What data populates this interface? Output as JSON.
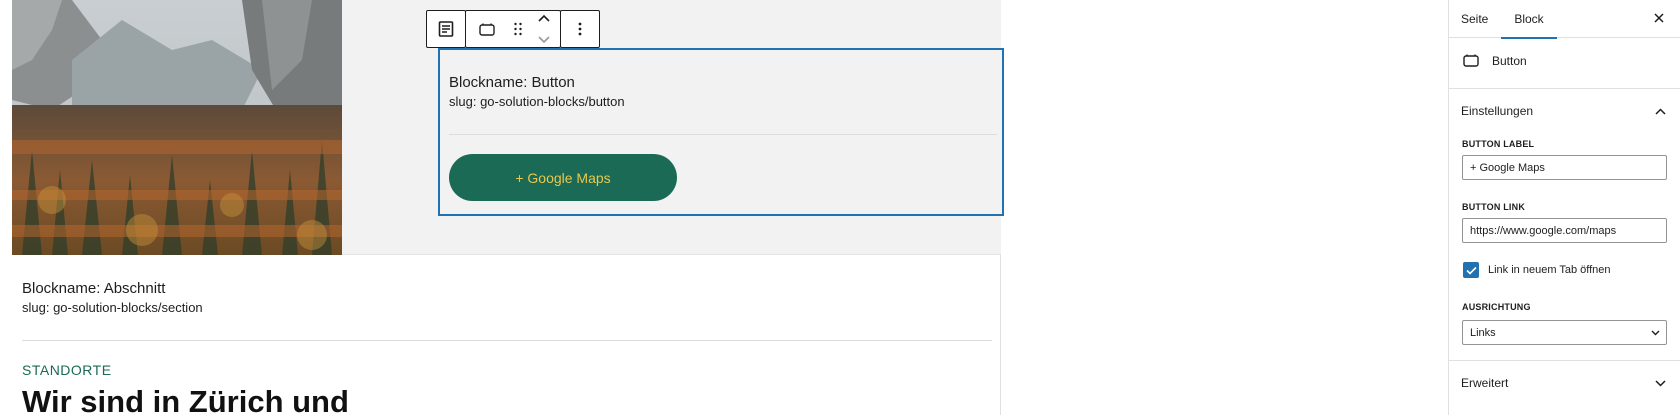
{
  "toolbar": {
    "paragraph_icon": "paragraph-block-icon",
    "block_icon": "button-block-icon",
    "drag_icon": "drag-handle-icon",
    "up_icon": "chevron-up-icon",
    "down_icon": "chevron-down-icon",
    "more_icon": "more-vertical-icon"
  },
  "button_block": {
    "name": "Blockname: Button",
    "slug": "slug: go-solution-blocks/button",
    "button_label": "+ Google Maps"
  },
  "section_block": {
    "name": "Blockname: Abschnitt",
    "slug": "slug: go-solution-blocks/section",
    "eyebrow": "STANDORTE",
    "heading": "Wir sind in Zürich und"
  },
  "sidebar": {
    "tabs": [
      {
        "label": "Seite",
        "active": false
      },
      {
        "label": "Block",
        "active": true
      }
    ],
    "close_icon": "close-icon",
    "block_card": {
      "title": "Button",
      "icon": "button-block-icon"
    },
    "settings_panel": {
      "title": "Einstellungen",
      "expanded": true,
      "button_label_label": "BUTTON LABEL",
      "button_label_value": "+ Google Maps",
      "button_link_label": "BUTTON LINK",
      "button_link_value": "https://www.google.com/maps",
      "checkbox_label": "Link in neuem Tab öffnen",
      "checkbox_checked": true,
      "alignment_label": "AUSRICHTUNG",
      "alignment_value": "Links"
    },
    "advanced_panel": {
      "title": "Erweitert",
      "expanded": false
    }
  },
  "colors": {
    "accent": "#2271b1",
    "button_bg": "#1a6a55",
    "button_text": "#e7c84b",
    "eyebrow": "#1a6a55"
  }
}
